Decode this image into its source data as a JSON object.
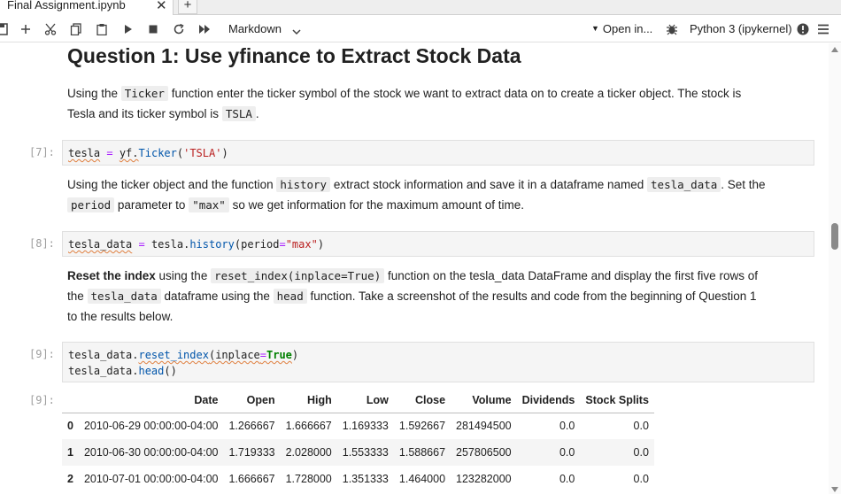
{
  "tab": {
    "title": "Final Assignment.ipynb",
    "close": "✕",
    "new_tab": "+"
  },
  "toolbar": {
    "cell_type": "Markdown",
    "open_in": "Open in...",
    "kernel": "Python 3 (ipykernel)"
  },
  "cells": {
    "heading": "Question 1: Use yfinance to Extract Stock Data",
    "md1": {
      "t1": "Using the ",
      "c1": "Ticker",
      "t2": " function enter the ticker symbol of the stock we want to extract data on to create a ticker object. The stock is",
      "t3": "Tesla and its ticker symbol is ",
      "c2": "TSLA",
      "t4": "."
    },
    "code7": {
      "prompt": "[7]:",
      "var": "tesla",
      "op": "=",
      "mod": "yf.",
      "fn": "Ticker",
      "open": "(",
      "str": "'TSLA'",
      "close": ")"
    },
    "md2": {
      "t1": "Using the ticker object and the function ",
      "c1": "history",
      "t2": " extract stock information and save it in a dataframe named ",
      "c2": "tesla_data",
      "t3": ". Set the",
      "c3": "period",
      "t4": " parameter to ",
      "c4": "\"max\"",
      "t5": " so we get information for the maximum amount of time."
    },
    "code8": {
      "prompt": "[8]:",
      "var": "tesla_data",
      "op": "=",
      "obj": "tesla.",
      "fn": "history",
      "arg": "(period",
      "eq": "=",
      "str": "\"max\"",
      "close": ")"
    },
    "md3": {
      "b1": "Reset the index",
      "t1": " using the ",
      "c1": "reset_index(inplace=True)",
      "t2": " function on the tesla_data DataFrame and display the first five rows of",
      "t3": "the ",
      "c2": "tesla_data",
      "t4": " dataframe using the ",
      "c3": "head",
      "t5": " function. Take a screenshot of the results and code from the beginning of Question 1",
      "t6": "to the results below."
    },
    "code9": {
      "prompt": "[9]:",
      "l1_obj": "tesla_data.",
      "l1_fn": "reset_index",
      "l1_arg": "(inplace",
      "l1_eq": "=",
      "l1_kw": "True",
      "l1_close": ")",
      "l2_obj": "tesla_data.",
      "l2_fn": "head",
      "l2_close": "()"
    },
    "out9": {
      "prompt": "[9]:",
      "columns": [
        "",
        "Date",
        "Open",
        "High",
        "Low",
        "Close",
        "Volume",
        "Dividends",
        "Stock Splits"
      ],
      "rows": [
        [
          "0",
          "2010-06-29 00:00:00-04:00",
          "1.266667",
          "1.666667",
          "1.169333",
          "1.592667",
          "281494500",
          "0.0",
          "0.0"
        ],
        [
          "1",
          "2010-06-30 00:00:00-04:00",
          "1.719333",
          "2.028000",
          "1.553333",
          "1.588667",
          "257806500",
          "0.0",
          "0.0"
        ],
        [
          "2",
          "2010-07-01 00:00:00-04:00",
          "1.666667",
          "1.728000",
          "1.351333",
          "1.464000",
          "123282000",
          "0.0",
          "0.0"
        ]
      ]
    }
  }
}
